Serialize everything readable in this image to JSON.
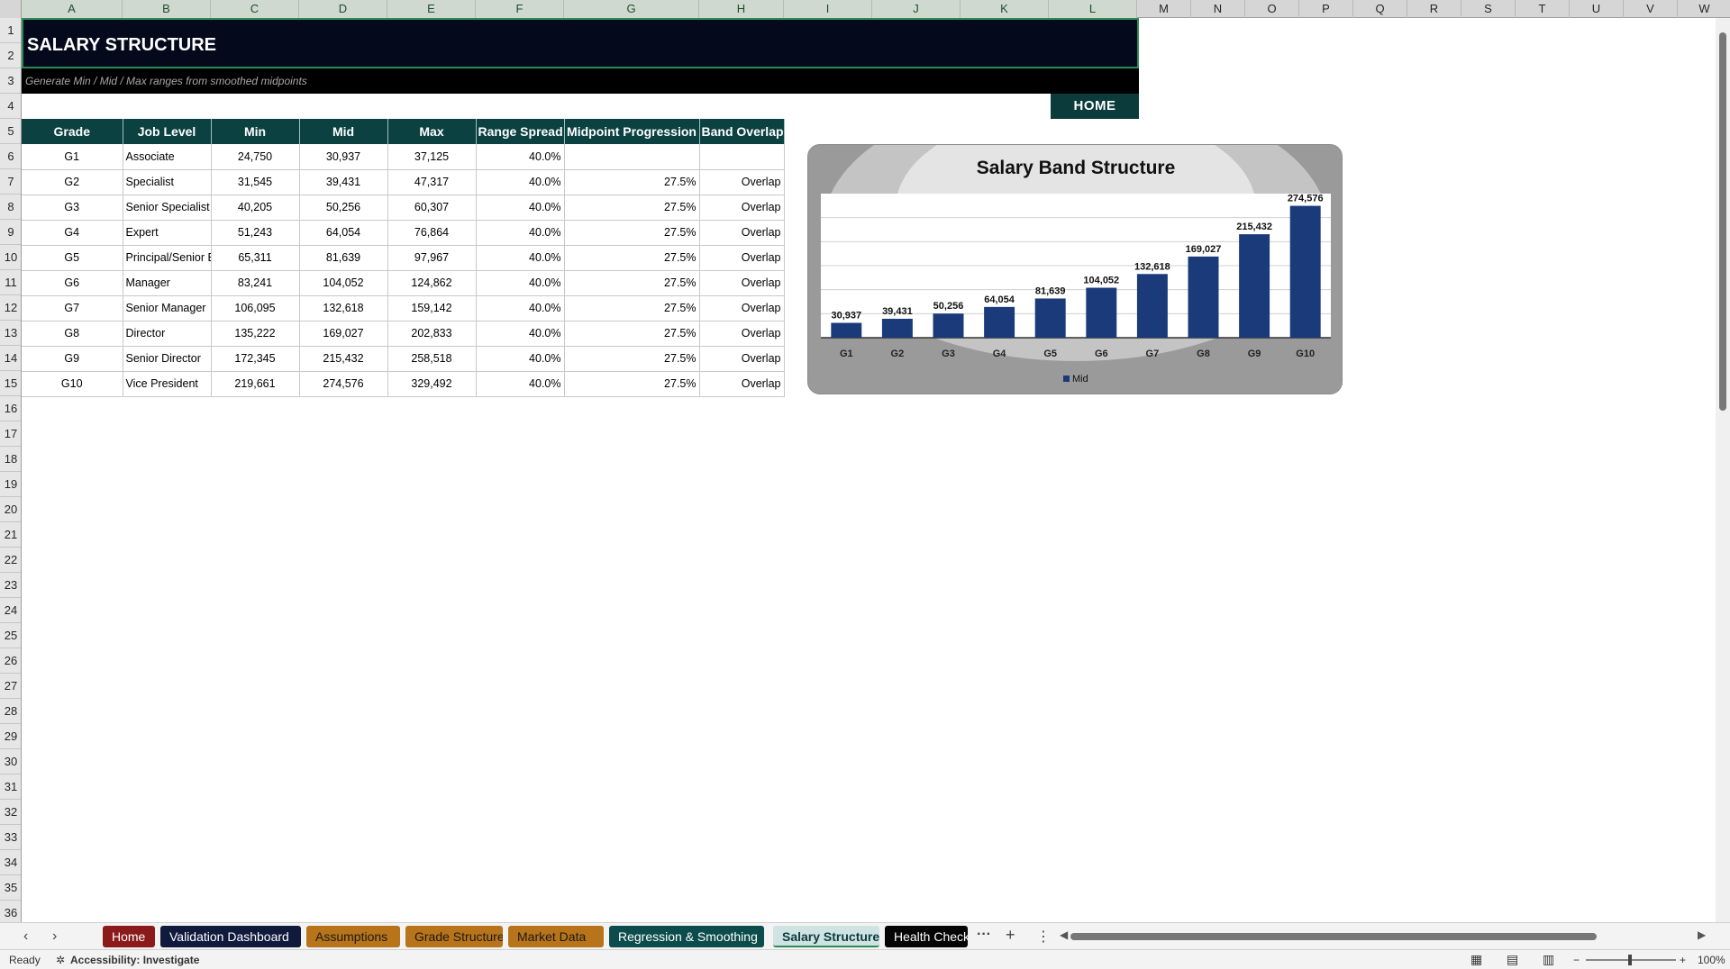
{
  "columns": [
    "A",
    "B",
    "C",
    "D",
    "E",
    "F",
    "G",
    "H",
    "I",
    "J",
    "K",
    "L",
    "M",
    "N",
    "O",
    "P",
    "Q",
    "R",
    "S",
    "T",
    "U",
    "V",
    "W"
  ],
  "rows": [
    "1",
    "2",
    "3",
    "4",
    "5",
    "6",
    "7",
    "8",
    "9",
    "10",
    "11",
    "12",
    "13",
    "14",
    "15",
    "16",
    "17",
    "18",
    "19",
    "20",
    "21",
    "22",
    "23",
    "24",
    "25",
    "26",
    "27",
    "28",
    "29",
    "30",
    "31",
    "32",
    "33",
    "34",
    "35",
    "36"
  ],
  "sheet": {
    "title": "SALARY STRUCTURE",
    "subtitle": "Generate Min / Mid / Max ranges from smoothed midpoints",
    "home_label": "HOME"
  },
  "table": {
    "headers": [
      "Grade",
      "Job Level",
      "Min",
      "Mid",
      "Max",
      "Range Spread",
      "Midpoint Progression",
      "Band Overlap"
    ],
    "rows": [
      [
        "G1",
        "Associate",
        "24,750",
        "30,937",
        "37,125",
        "40.0%",
        "",
        ""
      ],
      [
        "G2",
        "Specialist",
        "31,545",
        "39,431",
        "47,317",
        "40.0%",
        "27.5%",
        "Overlap"
      ],
      [
        "G3",
        "Senior Specialist",
        "40,205",
        "50,256",
        "60,307",
        "40.0%",
        "27.5%",
        "Overlap"
      ],
      [
        "G4",
        "Expert",
        "51,243",
        "64,054",
        "76,864",
        "40.0%",
        "27.5%",
        "Overlap"
      ],
      [
        "G5",
        "Principal/Senior E",
        "65,311",
        "81,639",
        "97,967",
        "40.0%",
        "27.5%",
        "Overlap"
      ],
      [
        "G6",
        "Manager",
        "83,241",
        "104,052",
        "124,862",
        "40.0%",
        "27.5%",
        "Overlap"
      ],
      [
        "G7",
        "Senior Manager",
        "106,095",
        "132,618",
        "159,142",
        "40.0%",
        "27.5%",
        "Overlap"
      ],
      [
        "G8",
        "Director",
        "135,222",
        "169,027",
        "202,833",
        "40.0%",
        "27.5%",
        "Overlap"
      ],
      [
        "G9",
        "Senior Director",
        "172,345",
        "215,432",
        "258,518",
        "40.0%",
        "27.5%",
        "Overlap"
      ],
      [
        "G10",
        "Vice President",
        "219,661",
        "274,576",
        "329,492",
        "40.0%",
        "27.5%",
        "Overlap"
      ]
    ]
  },
  "chart_data": {
    "type": "bar",
    "title": "Salary Band Structure",
    "categories": [
      "G1",
      "G2",
      "G3",
      "G4",
      "G5",
      "G6",
      "G7",
      "G8",
      "G9",
      "G10"
    ],
    "series": [
      {
        "name": "Mid",
        "values": [
          30937,
          39431,
          50256,
          64054,
          81639,
          104052,
          132618,
          169027,
          215432,
          274576
        ]
      }
    ],
    "data_labels": [
      "30,937",
      "39,431",
      "50,256",
      "64,054",
      "81,639",
      "104,052",
      "132,618",
      "169,027",
      "215,432",
      "274,576"
    ],
    "ylim": [
      0,
      300000
    ],
    "grid": true,
    "legend": "bottom",
    "bar_color": "#1a3a7a"
  },
  "tabs": [
    {
      "label": "Home",
      "bg": "#8b1a1a",
      "fg": "#ffffff"
    },
    {
      "label": "Validation Dashboard",
      "bg": "#0f1a3d",
      "fg": "#ffffff"
    },
    {
      "label": "Assumptions",
      "bg": "#b8741a",
      "fg": "#1a1a1a"
    },
    {
      "label": "Grade Structure",
      "bg": "#b8741a",
      "fg": "#1a1a1a"
    },
    {
      "label": "Market Data",
      "bg": "#b8741a",
      "fg": "#1a1a1a"
    },
    {
      "label": "Regression & Smoothing",
      "bg": "#0c4c4c",
      "fg": "#ffffff"
    },
    {
      "label": "Salary Structure",
      "bg": "#cfe3e3",
      "fg": "#0c3b3b"
    },
    {
      "label": "Health Check",
      "bg": "#050505",
      "fg": "#ffffff"
    }
  ],
  "tabbar": {
    "more": "···",
    "add": "+",
    "options": "⋮"
  },
  "status": {
    "ready": "Ready",
    "accessibility": "Accessibility: Investigate",
    "zoom": "100%"
  }
}
